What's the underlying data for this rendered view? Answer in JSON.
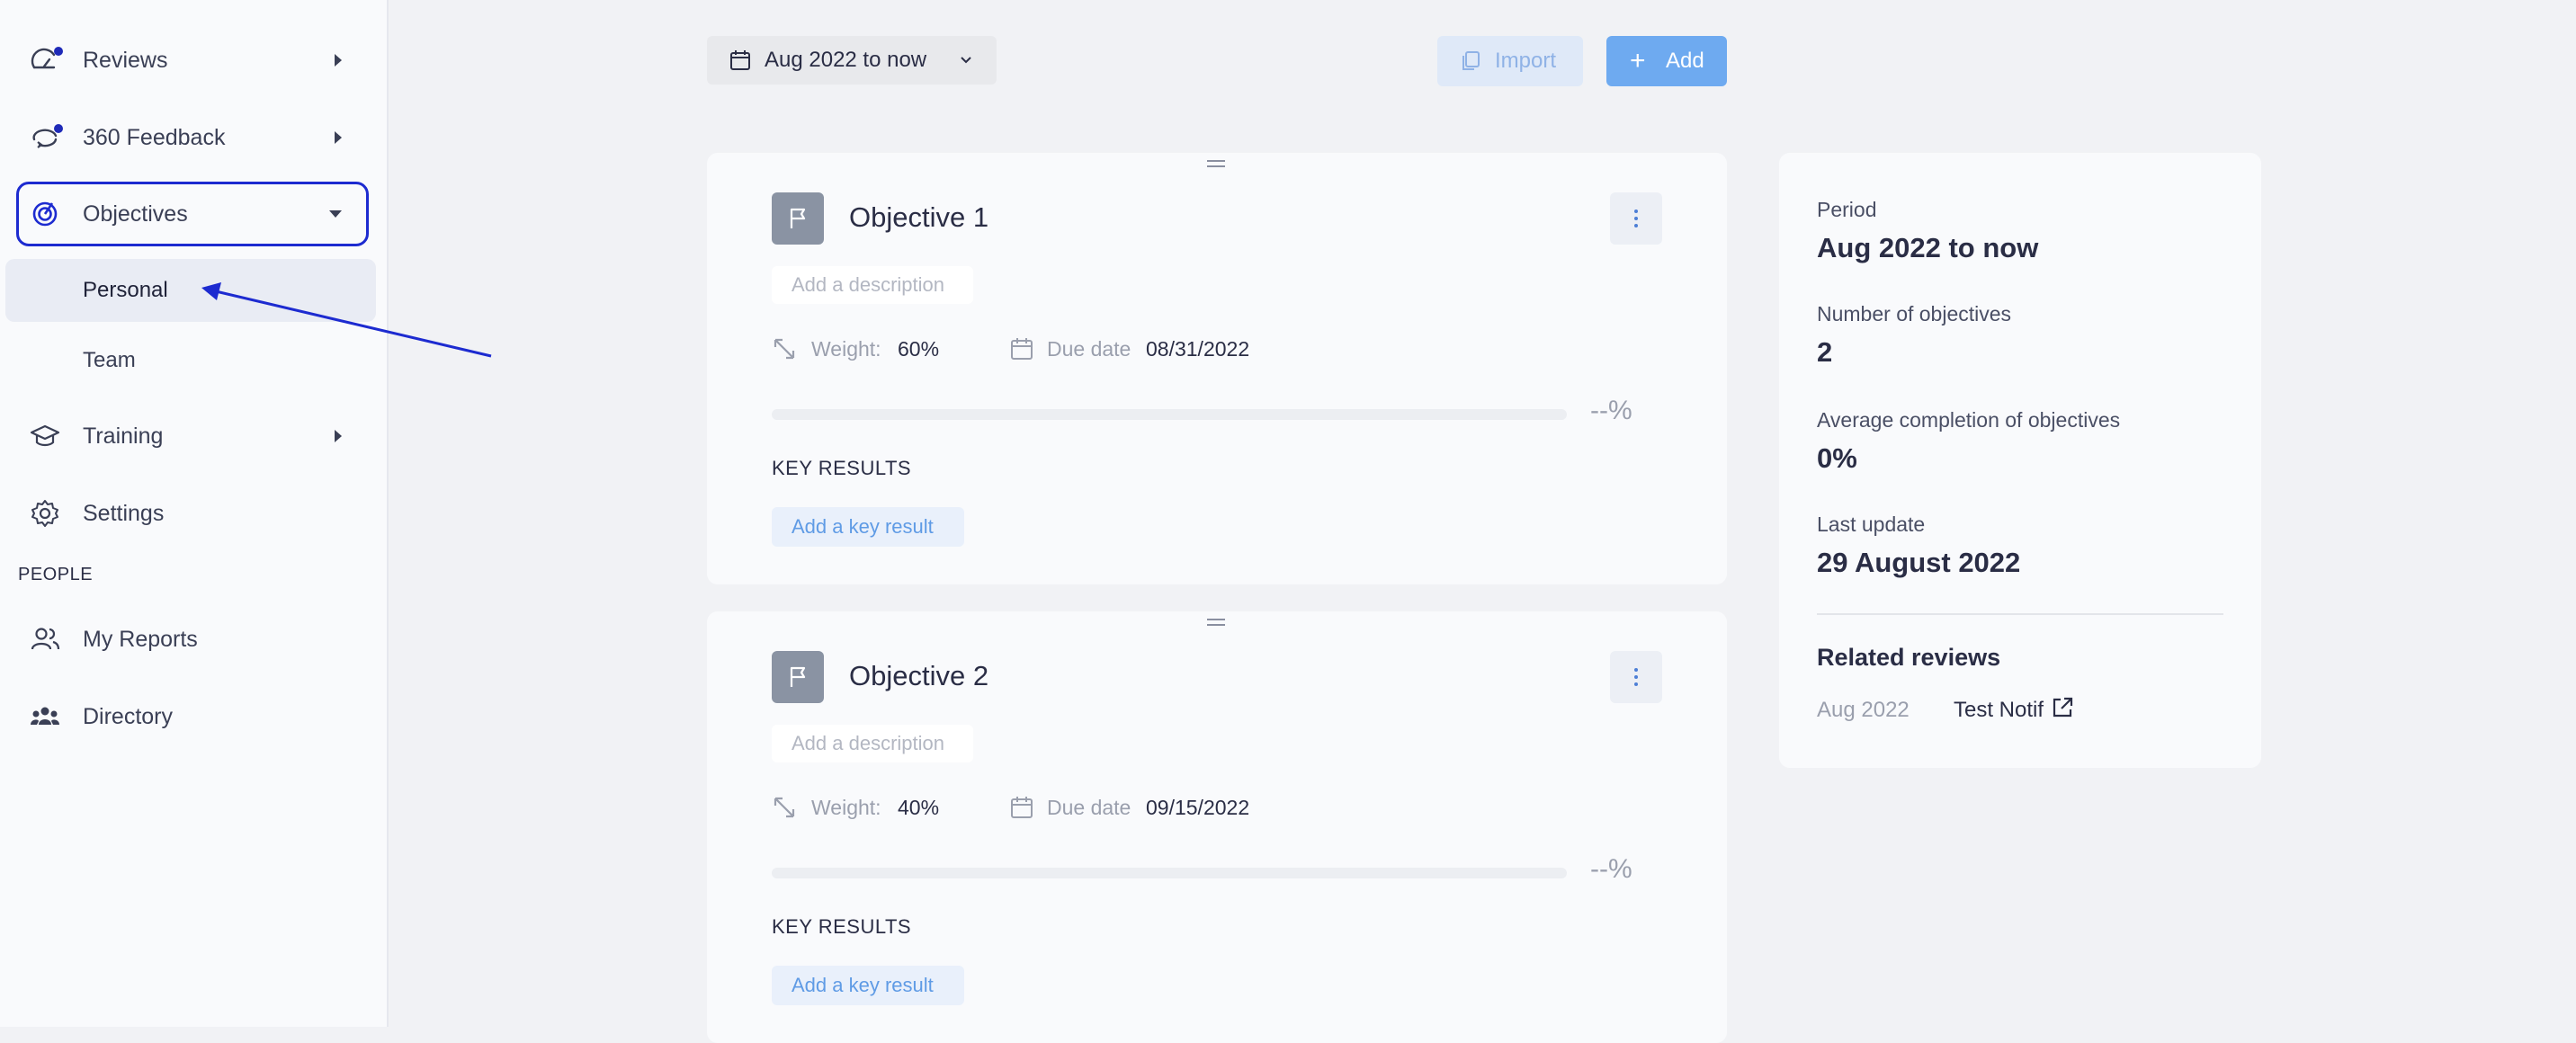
{
  "sidebar": {
    "items": [
      {
        "label": "Reviews",
        "icon": "gauge-icon"
      },
      {
        "label": "360 Feedback",
        "icon": "feedback-loop-icon"
      },
      {
        "label": "Objectives",
        "icon": "target-icon"
      },
      {
        "label": "Training",
        "icon": "graduation-cap-icon"
      },
      {
        "label": "Settings",
        "icon": "gear-icon"
      }
    ],
    "sub_items": [
      "Personal",
      "Team"
    ],
    "people_section": "PEOPLE",
    "people_items": [
      {
        "label": "My Reports",
        "icon": "users-icon"
      },
      {
        "label": "Directory",
        "icon": "group-icon"
      }
    ],
    "accent_color": "#1d2bd0"
  },
  "toolbar": {
    "period_label": "Aug 2022 to now",
    "import_label": "Import",
    "add_label": "Add"
  },
  "objectives": [
    {
      "title": "Objective 1",
      "description_placeholder": "Add a description",
      "weight_label": "Weight:",
      "weight": "60%",
      "due_label": "Due date",
      "due_date": "08/31/2022",
      "progress_text": "--%",
      "progress_fraction": 0,
      "key_results_title": "KEY RESULTS",
      "add_key_result": "Add a key result"
    },
    {
      "title": "Objective 2",
      "description_placeholder": "Add a description",
      "weight_label": "Weight:",
      "weight": "40%",
      "due_label": "Due date",
      "due_date": "09/15/2022",
      "progress_text": "--%",
      "progress_fraction": 0,
      "key_results_title": "KEY RESULTS",
      "add_key_result": "Add a key result"
    }
  ],
  "summary": {
    "period_label": "Period",
    "period_value": "Aug 2022 to now",
    "count_label": "Number of objectives",
    "count_value": "2",
    "completion_label": "Average completion of objectives",
    "completion_value": "0%",
    "update_label": "Last update",
    "update_value": "29 August 2022",
    "related_title": "Related reviews",
    "related": [
      {
        "date": "Aug 2022",
        "name": "Test Notif"
      }
    ]
  }
}
